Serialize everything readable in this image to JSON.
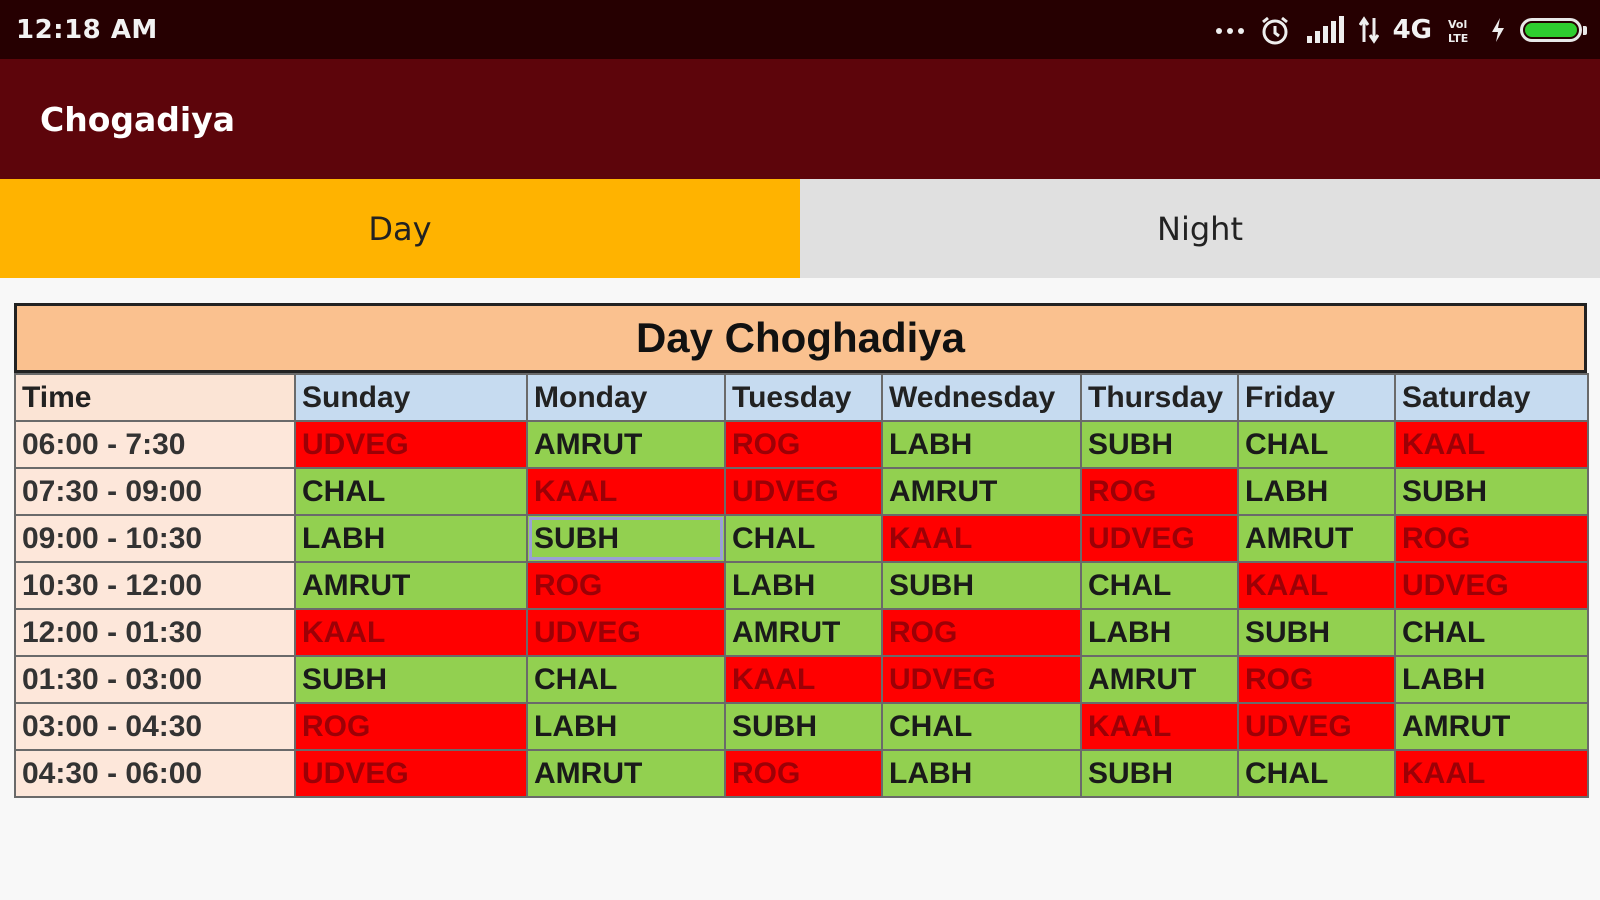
{
  "status_bar": {
    "time": "12:18 AM",
    "icons": [
      "more-dots-icon",
      "alarm-icon",
      "signal-icon",
      "data-arrows-icon",
      "volte-icon",
      "charging-icon",
      "battery-icon"
    ],
    "network": "4G",
    "battery_level": 1.0,
    "colors": {
      "background": "#260001",
      "battery": "#2fcd2f"
    }
  },
  "app_bar": {
    "title": "Chogadiya",
    "color": "#5d050b"
  },
  "tabs": [
    {
      "label": "Day",
      "active": true,
      "color": "#ffb300"
    },
    {
      "label": "Night",
      "active": false,
      "color": "#e0e0e0"
    }
  ],
  "table": {
    "title": "Day Choghadiya",
    "headers": [
      "Time",
      "Sunday",
      "Monday",
      "Tuesday",
      "Wednesday",
      "Thursday",
      "Friday",
      "Saturday"
    ],
    "rows": [
      {
        "time": "06:00 - 7:30",
        "cells": [
          "UDVEG",
          "AMRUT",
          "ROG",
          "LABH",
          "SUBH",
          "CHAL",
          "KAAL"
        ]
      },
      {
        "time": "07:30 - 09:00",
        "cells": [
          "CHAL",
          "KAAL",
          "UDVEG",
          "AMRUT",
          "ROG",
          "LABH",
          "SUBH"
        ]
      },
      {
        "time": "09:00 - 10:30",
        "cells": [
          "LABH",
          "SUBH",
          "CHAL",
          "KAAL",
          "UDVEG",
          "AMRUT",
          "ROG"
        ]
      },
      {
        "time": "10:30 - 12:00",
        "cells": [
          "AMRUT",
          "ROG",
          "LABH",
          "SUBH",
          "CHAL",
          "KAAL",
          "UDVEG"
        ]
      },
      {
        "time": "12:00 - 01:30",
        "cells": [
          "KAAL",
          "UDVEG",
          "AMRUT",
          "ROG",
          "LABH",
          "SUBH",
          "CHAL"
        ]
      },
      {
        "time": "01:30 - 03:00",
        "cells": [
          "SUBH",
          "CHAL",
          "KAAL",
          "UDVEG",
          "AMRUT",
          "ROG",
          "LABH"
        ]
      },
      {
        "time": "03:00 - 04:30",
        "cells": [
          "ROG",
          "LABH",
          "SUBH",
          "CHAL",
          "KAAL",
          "UDVEG",
          "AMRUT"
        ]
      },
      {
        "time": "04:30 - 06:00",
        "cells": [
          "UDVEG",
          "AMRUT",
          "ROG",
          "LABH",
          "SUBH",
          "CHAL",
          "KAAL"
        ]
      }
    ],
    "selected_cell": {
      "row": 2,
      "col": 1
    },
    "colors": {
      "title_bg": "#fac18f",
      "header_bg": "#c6dbf0",
      "time_bg": "#fde7da",
      "auspicious_bg": "#92d050",
      "inauspicious_bg": "#ff0000",
      "inauspicious_text": "#9c0006"
    }
  }
}
